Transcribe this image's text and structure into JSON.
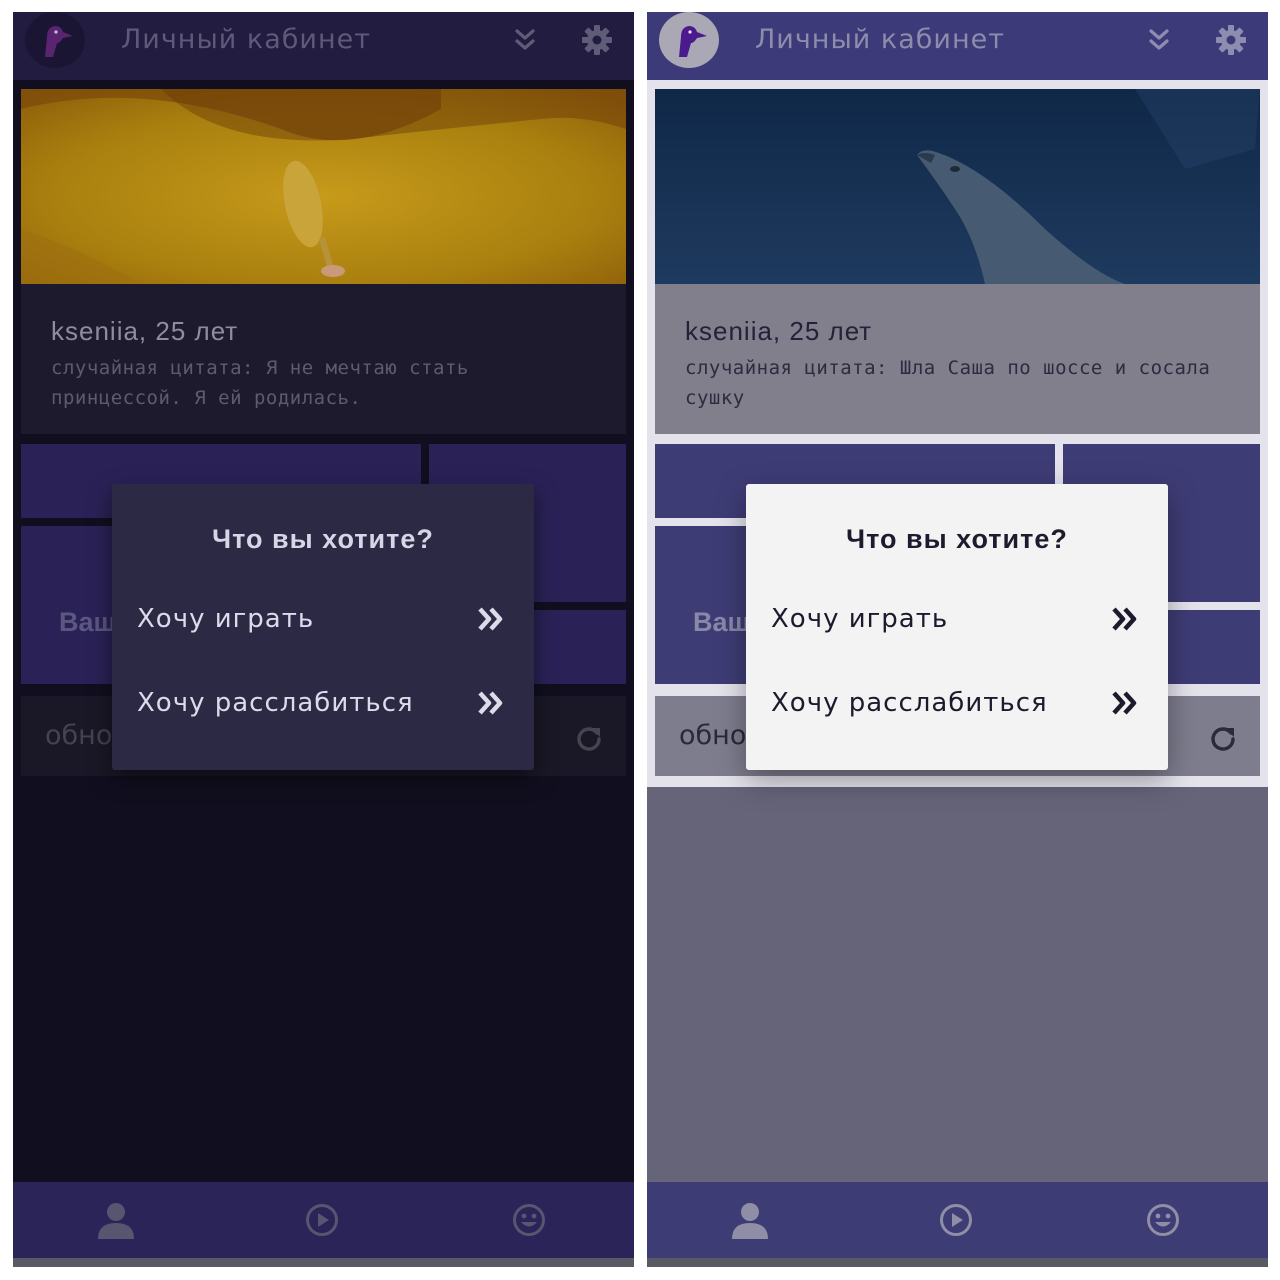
{
  "screens": [
    {
      "theme": "dark",
      "header": {
        "title": "Личный кабинет"
      },
      "profile": {
        "name": "kseniia, 25 лет",
        "quote": "случайная цитата: Я не мечтаю стать принцессой. Я ей родилась."
      },
      "tiles": {
        "partial_label": "Ваш"
      },
      "refresh": {
        "label": "обно"
      },
      "dialog": {
        "title": "Что вы хотите?",
        "options": [
          {
            "label": "Хочу играть"
          },
          {
            "label": "Хочу расслабиться"
          }
        ]
      },
      "bottom_nav": {
        "icons": [
          "profile-icon",
          "play-icon",
          "smiley-icon"
        ]
      },
      "colors": {
        "accent": "#2a2458",
        "background": "#110f1f"
      }
    },
    {
      "theme": "light",
      "header": {
        "title": "Личный кабинет"
      },
      "profile": {
        "name": "kseniia, 25 лет",
        "quote": "случайная цитата: Шла Саша по шоссе и сосала сушку"
      },
      "tiles": {
        "partial_label": "Ваш"
      },
      "refresh": {
        "label": "обно"
      },
      "dialog": {
        "title": "Что вы хотите?",
        "options": [
          {
            "label": "Хочу играть"
          },
          {
            "label": "Хочу расслабиться"
          }
        ]
      },
      "bottom_nav": {
        "icons": [
          "profile-icon",
          "play-icon",
          "smiley-icon"
        ]
      },
      "colors": {
        "accent": "#3e3c74",
        "background": "#e4e3ec"
      }
    }
  ]
}
